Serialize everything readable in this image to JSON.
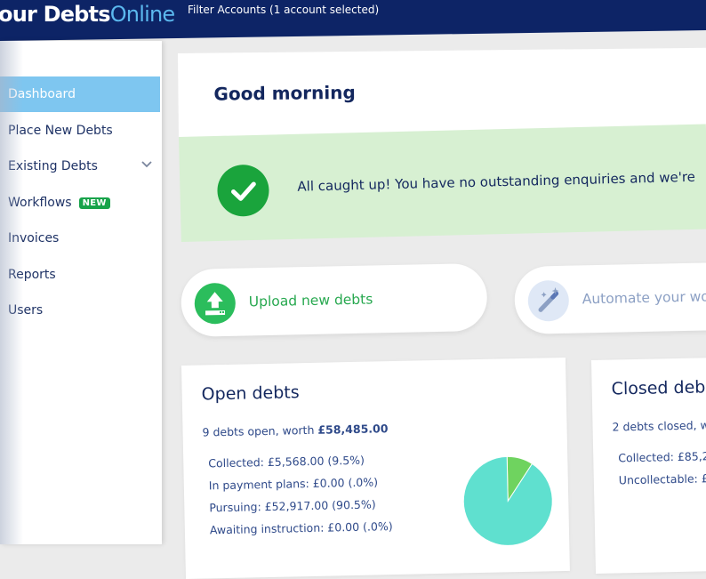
{
  "header": {
    "brand_main": "our Debts",
    "brand_online": "Online",
    "filter_label": "Filter Accounts (1 account selected)"
  },
  "sidebar": {
    "items": [
      {
        "label": "Dashboard",
        "active": true
      },
      {
        "label": "Place New Debts"
      },
      {
        "label": "Existing Debts",
        "has_dropdown": true
      },
      {
        "label": "Workflows",
        "badge": "NEW"
      },
      {
        "label": "Invoices"
      },
      {
        "label": "Reports"
      },
      {
        "label": "Users"
      }
    ]
  },
  "greeting": {
    "title": "Good morning"
  },
  "banner": {
    "text": "All caught up! You have no outstanding enquiries and we're",
    "icon": "check-icon"
  },
  "actions": [
    {
      "label": "Upload new debts",
      "icon": "upload-icon"
    },
    {
      "label": "Automate your wo",
      "icon": "magic-wand-icon"
    }
  ],
  "open_debts": {
    "title": "Open debts",
    "summary_prefix": "9 debts open, worth ",
    "summary_amount": "£58,485.00",
    "stats": [
      "Collected: £5,568.00 (9.5%)",
      "In payment plans: £0.00 (.0%)",
      "Pursuing: £52,917.00 (90.5%)",
      "Awaiting instruction: £0.00 (.0%)"
    ],
    "pie": {
      "collected_percent": 9.5,
      "pursuing_percent": 90.5,
      "colors": {
        "collected": "#6fd35f",
        "pursuing": "#5fe0cf"
      }
    }
  },
  "closed_debts": {
    "title": "Closed deb",
    "summary": "2 debts closed, w",
    "stats": [
      "Collected: £85,2",
      "Uncollectable: £"
    ]
  },
  "colors": {
    "header_bg": "#0d2466",
    "accent_blue": "#7ec6f0",
    "success_green": "#1aa43c",
    "banner_bg": "#d7f0d2"
  }
}
